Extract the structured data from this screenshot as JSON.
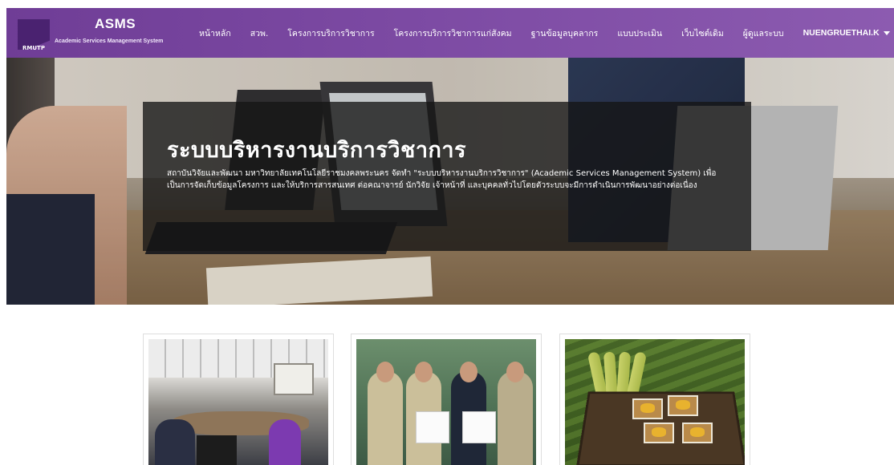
{
  "brand": {
    "logo_text": "RMUTP",
    "name": "ASMS",
    "subtitle": "Academic Services Management System"
  },
  "nav": {
    "items": [
      "หน้าหลัก",
      "สวพ.",
      "โครงการบริการวิชาการ",
      "โครงการบริการวิชาการแก่สังคม",
      "ฐานข้อมูลบุคลากร",
      "แบบประเมิน",
      "เว็บไซต์เดิม",
      "ผู้ดูแลระบบ"
    ],
    "user": "NUENGRUETHAI.K"
  },
  "hero": {
    "title": "ระบบบริหารงานบริการวิชาการ",
    "description": "สถาบันวิจัยและพัฒนา มหาวิทยาลัยเทคโนโลยีราชมงคลพระนคร จัดทำ \"ระบบบริหารงานบริการวิชาการ\" (Academic Services Management System) เพื่อเป็นการจัดเก็บข้อมูลโครงการ และให้บริการสารสนเทศ ต่อคณาจารย์ นักวิจัย เจ้าหน้าที่ และบุคคลทั่วไปโดยตัวระบบจะมีการดำเนินการพัฒนาอย่างต่อเนื่อง"
  },
  "colors": {
    "nav_bg": "#7c4aa3",
    "brand_dark": "#4a2270",
    "hero_box": "rgba(20,20,20,0.78)"
  }
}
